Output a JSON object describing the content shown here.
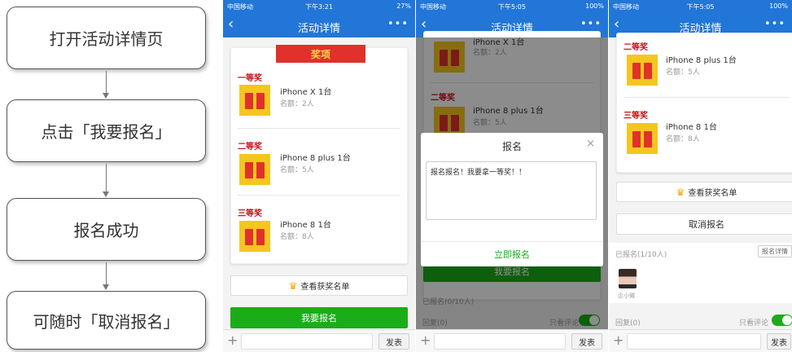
{
  "flow": {
    "steps": [
      "打开活动详情页",
      "点击「我要报名」",
      "报名成功",
      "可随时「取消报名」"
    ]
  },
  "colors": {
    "nav": "#2176d8",
    "green": "#1aad19",
    "prize_red": "#c8141a",
    "gift_yellow": "#f6c61f"
  },
  "common": {
    "carrier": "中国移动",
    "nav_title": "活动详情",
    "back_icon": "chevron-left-icon",
    "more_icon": "ellipsis-icon",
    "send_label": "发表",
    "plus_icon": "plus-icon",
    "view_winners": "查看获奖名单",
    "crown_icon": "crown-icon",
    "only_comments": "只看评论",
    "first": "一等奖",
    "second": "二等奖",
    "third": "三等奖",
    "iphonex": "iPhone X 1台",
    "iphone8plus": "iPhone 8 plus 1台",
    "iphone8": "iPhone 8 1台",
    "quota2": "名额：2人",
    "quota5": "名额：5人",
    "quota8": "名额：8人"
  },
  "phone1": {
    "time": "下午3:21",
    "status_right": "27%",
    "banner": "奖项",
    "register_button": "我要报名"
  },
  "phone2": {
    "time": "下午5:05",
    "status_right": "100%",
    "top_partial": "iPhone X 1台",
    "dialog": {
      "title": "报名",
      "close_icon": "close-icon",
      "text": "报名报名！我要拿一等奖！！",
      "submit": "立即报名"
    },
    "register_button": "我要报名",
    "registered": "已报名(0/10人)",
    "reply": "回复(0)"
  },
  "phone3": {
    "time": "下午5:05",
    "status_right": "100%",
    "cancel_button": "取消报名",
    "registered": "已报名(1/10人)",
    "detail_button": "报名详情",
    "user_name": "企小微",
    "reply": "回复(0)"
  }
}
